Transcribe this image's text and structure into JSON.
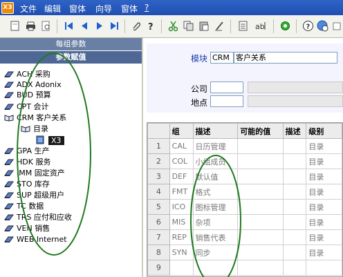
{
  "app": {
    "logo_text": "X3"
  },
  "menu": [
    {
      "label": "文件",
      "mnemonic": "F"
    },
    {
      "label": "编辑",
      "mnemonic": "E"
    },
    {
      "label": "窗体",
      "mnemonic": "W"
    },
    {
      "label": "向导",
      "mnemonic": "Z"
    },
    {
      "label": "窗体",
      "mnemonic": "W"
    },
    {
      "label": "?",
      "mnemonic": ""
    }
  ],
  "left_panel": {
    "header1": "每组参数",
    "header2": "参数赋值",
    "tree": [
      {
        "label": "ACH 采购"
      },
      {
        "label": "ADX Adonix"
      },
      {
        "label": "BUD 预算"
      },
      {
        "label": "CPT 会计"
      },
      {
        "label": "CRM 客户关系",
        "expanded": true
      },
      {
        "label": "GPA 生产"
      },
      {
        "label": "HDK 服务"
      },
      {
        "label": "IMM 固定资产"
      },
      {
        "label": "STO 库存"
      },
      {
        "label": "SUP 超级用户"
      },
      {
        "label": "TC 数据"
      },
      {
        "label": "TRS 应付和应收"
      },
      {
        "label": "VEN 销售"
      },
      {
        "label": "WEB Internet"
      }
    ],
    "subtree": {
      "folder": "目录",
      "leaf": "X3"
    }
  },
  "form": {
    "module_label": "模块",
    "module_code": "CRM",
    "module_name": "客户关系",
    "company_label": "公司",
    "site_label": "地点",
    "module_label_color": "#1a3ea8"
  },
  "grid": {
    "columns": [
      "组",
      "描述",
      "可能的值",
      "描述",
      "级别"
    ],
    "rows": [
      {
        "num": "1",
        "group": "CAL",
        "desc": "日历管理",
        "values": "",
        "desc2": "",
        "level": "目录"
      },
      {
        "num": "2",
        "group": "COL",
        "desc": "小组成员",
        "values": "",
        "desc2": "",
        "level": "目录"
      },
      {
        "num": "3",
        "group": "DEF",
        "desc": "默认值",
        "values": "",
        "desc2": "",
        "level": "目录"
      },
      {
        "num": "4",
        "group": "FMT",
        "desc": "格式",
        "values": "",
        "desc2": "",
        "level": "目录"
      },
      {
        "num": "5",
        "group": "ICO",
        "desc": "图标管理",
        "values": "",
        "desc2": "",
        "level": "目录"
      },
      {
        "num": "6",
        "group": "MIS",
        "desc": "杂项",
        "values": "",
        "desc2": "",
        "level": "目录"
      },
      {
        "num": "7",
        "group": "REP",
        "desc": "销售代表",
        "values": "",
        "desc2": "",
        "level": "目录"
      },
      {
        "num": "8",
        "group": "SYN",
        "desc": "同步",
        "values": "",
        "desc2": "",
        "level": "目录"
      },
      {
        "num": "9",
        "group": "",
        "desc": "",
        "values": "",
        "desc2": "",
        "level": ""
      }
    ]
  },
  "colors": {
    "menubar": "#2a5bc0",
    "panel_header": "#4f6794",
    "annotation": "#1f7a1f"
  }
}
